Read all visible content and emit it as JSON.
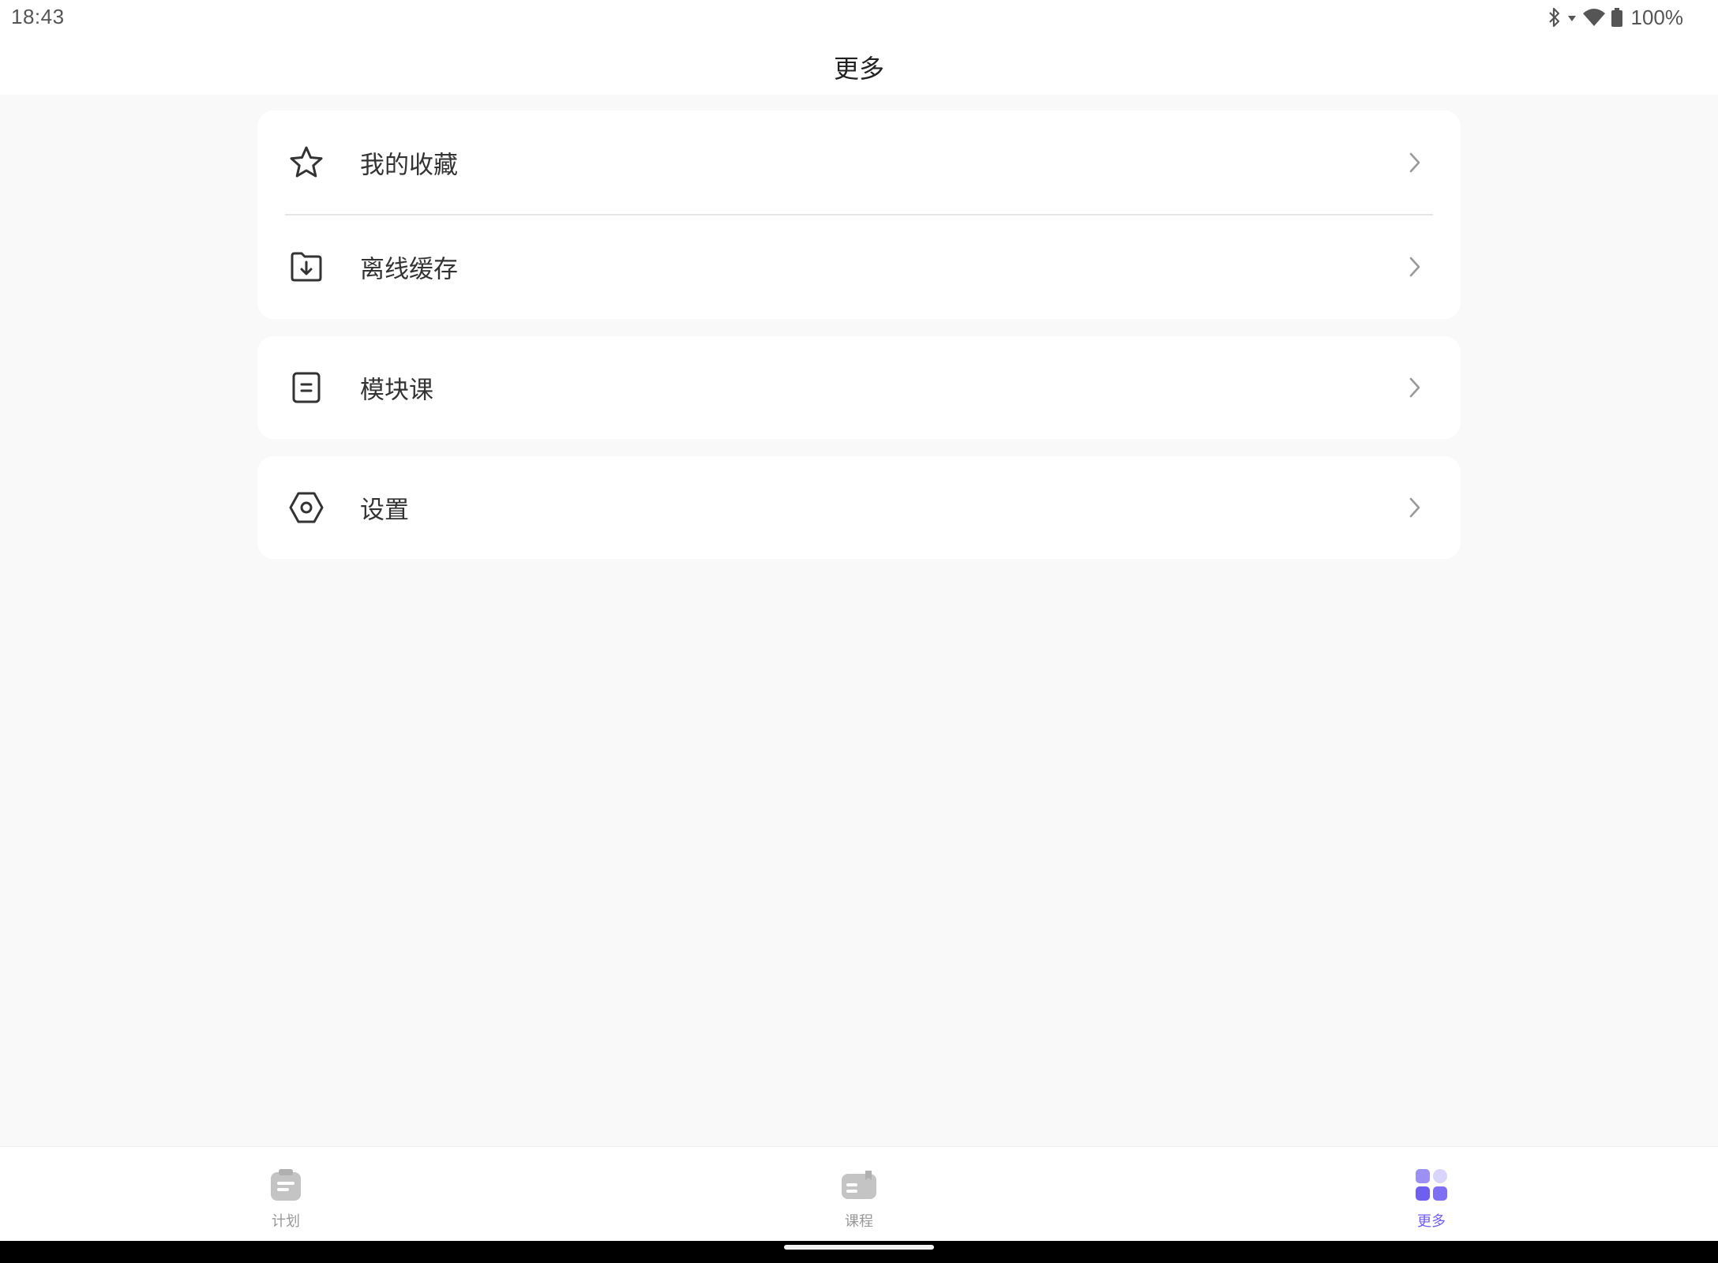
{
  "status_bar": {
    "time": "18:43",
    "battery": "100%",
    "icons": [
      "bluetooth-icon",
      "signal-arrow-icon",
      "wifi-icon",
      "battery-icon"
    ]
  },
  "header": {
    "title": "更多"
  },
  "menu": {
    "favorites": {
      "label": "我的收藏",
      "icon": "star-icon"
    },
    "offline": {
      "label": "离线缓存",
      "icon": "folder-download-icon"
    },
    "modules": {
      "label": "模块课",
      "icon": "document-icon"
    },
    "settings": {
      "label": "设置",
      "icon": "hexagon-gear-icon"
    }
  },
  "tabs": {
    "plan": {
      "label": "计划",
      "icon": "clipboard-icon",
      "active": false
    },
    "courses": {
      "label": "课程",
      "icon": "book-icon",
      "active": false
    },
    "more": {
      "label": "更多",
      "icon": "grid-icon",
      "active": true
    }
  },
  "colors": {
    "accent": "#6f5ff0",
    "accent_light": "#c9c3fa",
    "inactive_tab_icon": "#c4c4c4",
    "background": "#f9f9f9",
    "card": "#ffffff",
    "text_primary": "#333333",
    "chevron": "#999999"
  }
}
